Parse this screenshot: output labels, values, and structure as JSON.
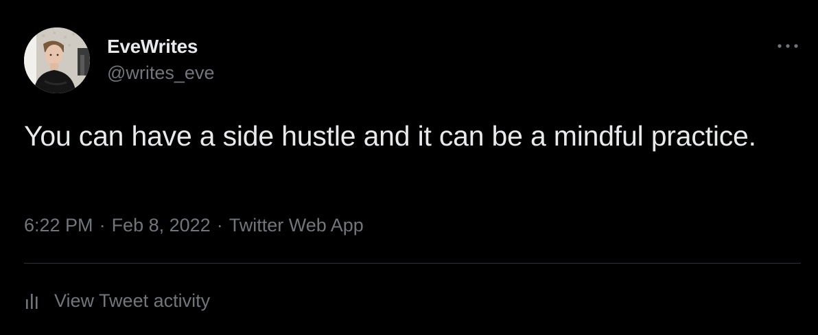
{
  "colors": {
    "background": "#000000",
    "primary_text": "#e7e9ea",
    "secondary_text": "#71767b",
    "divider": "#2f3336"
  },
  "author": {
    "display_name": "EveWrites",
    "handle": "@writes_eve",
    "avatar_icon": "user-avatar"
  },
  "more_icon": "more-horizontal-icon",
  "tweet": {
    "text": "You can have a side hustle and it can be a mindful practice.",
    "time": "6:22 PM",
    "separator": "·",
    "date": "Feb 8, 2022",
    "source": "Twitter Web App"
  },
  "activity": {
    "icon": "analytics-icon",
    "label": "View Tweet activity"
  }
}
